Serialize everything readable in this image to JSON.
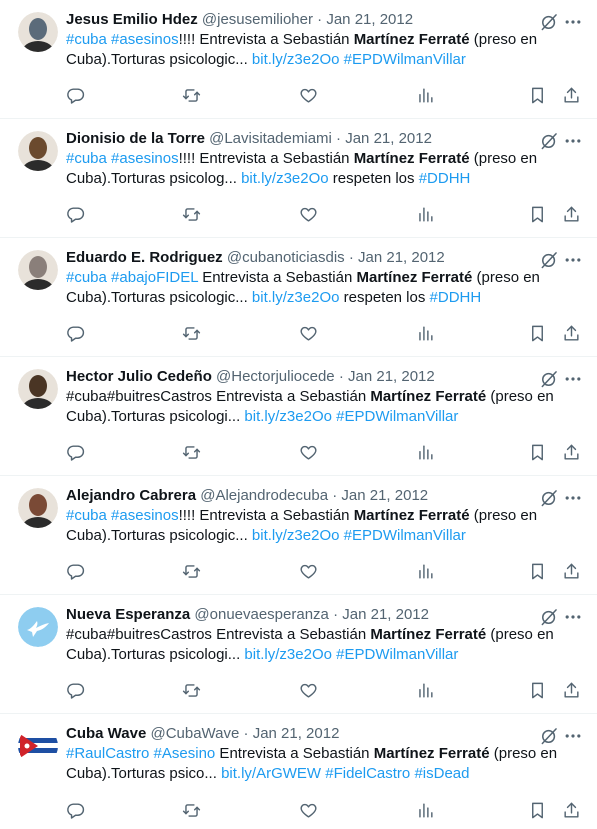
{
  "tweets": [
    {
      "name": "Jesus Emilio Hdez",
      "handle": "@jesusemilioher",
      "date": "Jan 21, 2012",
      "avatar_bg": "#5b6b7a",
      "segments": [
        {
          "t": "#cuba",
          "s": "link"
        },
        {
          "t": " ",
          "s": "text"
        },
        {
          "t": "#asesinos",
          "s": "link"
        },
        {
          "t": "!!!! Entrevista a Sebastián ",
          "s": "text"
        },
        {
          "t": "Martínez Ferraté",
          "s": "bold"
        },
        {
          "t": " (preso en Cuba).Torturas psicologic... ",
          "s": "text"
        },
        {
          "t": "bit.ly/z3e2Oo",
          "s": "link"
        },
        {
          "t": " ",
          "s": "text"
        },
        {
          "t": "#EPDWilmanVillar",
          "s": "link"
        }
      ]
    },
    {
      "name": "Dionisio de la Torre",
      "handle": "@Lavisitademiami",
      "date": "Jan 21, 2012",
      "avatar_bg": "#6b4a2e",
      "segments": [
        {
          "t": "#cuba",
          "s": "link"
        },
        {
          "t": " ",
          "s": "text"
        },
        {
          "t": "#asesinos",
          "s": "link"
        },
        {
          "t": "!!!! Entrevista a Sebastián ",
          "s": "text"
        },
        {
          "t": "Martínez Ferraté",
          "s": "bold"
        },
        {
          "t": " (preso en Cuba).Torturas psicolog... ",
          "s": "text"
        },
        {
          "t": "bit.ly/z3e2Oo",
          "s": "link"
        },
        {
          "t": " respeten los ",
          "s": "text"
        },
        {
          "t": "#DDHH",
          "s": "link"
        }
      ]
    },
    {
      "name": "Eduardo E. Rodriguez",
      "handle": "@cubanoticiasdis",
      "date": "Jan 21, 2012",
      "avatar_bg": "#8a7f7a",
      "segments": [
        {
          "t": "#cuba",
          "s": "link"
        },
        {
          "t": " ",
          "s": "text"
        },
        {
          "t": "#abajoFIDEL",
          "s": "link"
        },
        {
          "t": " Entrevista a Sebastián ",
          "s": "text"
        },
        {
          "t": "Martínez Ferraté",
          "s": "bold"
        },
        {
          "t": " (preso en Cuba).Torturas psicologic... ",
          "s": "text"
        },
        {
          "t": "bit.ly/z3e2Oo",
          "s": "link"
        },
        {
          "t": " respeten los ",
          "s": "text"
        },
        {
          "t": "#DDHH",
          "s": "link"
        }
      ]
    },
    {
      "name": "Hector Julio Cedeño",
      "handle": "@Hectorjuliocede",
      "date": "Jan 21, 2012",
      "avatar_bg": "#4a3524",
      "segments": [
        {
          "t": "#cuba#buitresCastros Entrevista a Sebastián ",
          "s": "text"
        },
        {
          "t": "Martínez Ferraté",
          "s": "bold"
        },
        {
          "t": " (preso en Cuba).Torturas psicologi... ",
          "s": "text"
        },
        {
          "t": "bit.ly/z3e2Oo",
          "s": "link"
        },
        {
          "t": " ",
          "s": "text"
        },
        {
          "t": "#EPDWilmanVillar",
          "s": "link"
        }
      ]
    },
    {
      "name": "Alejandro Cabrera",
      "handle": "@Alejandrodecuba",
      "date": "Jan 21, 2012",
      "avatar_bg": "#7a4a36",
      "segments": [
        {
          "t": "#cuba",
          "s": "link"
        },
        {
          "t": " ",
          "s": "text"
        },
        {
          "t": "#asesinos",
          "s": "link"
        },
        {
          "t": "!!!! Entrevista a Sebastián ",
          "s": "text"
        },
        {
          "t": "Martínez Ferraté",
          "s": "bold"
        },
        {
          "t": " (preso en Cuba).Torturas psicologic... ",
          "s": "text"
        },
        {
          "t": "bit.ly/z3e2Oo",
          "s": "link"
        },
        {
          "t": " ",
          "s": "text"
        },
        {
          "t": "#EPDWilmanVillar",
          "s": "link"
        }
      ]
    },
    {
      "name": "Nueva Esperanza",
      "handle": "@onuevaesperanza",
      "date": "Jan 21, 2012",
      "avatar_bg": "#8ecdf0",
      "segments": [
        {
          "t": "#cuba#buitresCastros Entrevista a Sebastián ",
          "s": "text"
        },
        {
          "t": "Martínez Ferraté",
          "s": "bold"
        },
        {
          "t": " (preso en Cuba).Torturas psicologi... ",
          "s": "text"
        },
        {
          "t": "bit.ly/z3e2Oo",
          "s": "link"
        },
        {
          "t": " ",
          "s": "text"
        },
        {
          "t": "#EPDWilmanVillar",
          "s": "link"
        }
      ]
    },
    {
      "name": "Cuba Wave",
      "handle": "@CubaWave",
      "date": "Jan 21, 2012",
      "avatar_bg": "#1e4fa3",
      "segments": [
        {
          "t": "#RaulCastro",
          "s": "link"
        },
        {
          "t": " ",
          "s": "text"
        },
        {
          "t": "#Asesino",
          "s": "link"
        },
        {
          "t": " Entrevista a Sebastián ",
          "s": "text"
        },
        {
          "t": "Martínez Ferraté",
          "s": "bold"
        },
        {
          "t": " (preso en Cuba).Torturas psico... ",
          "s": "text"
        },
        {
          "t": "bit.ly/ArGWEW",
          "s": "link"
        },
        {
          "t": " ",
          "s": "text"
        },
        {
          "t": "#FidelCastro",
          "s": "link"
        },
        {
          "t": " ",
          "s": "text"
        },
        {
          "t": "#isDead",
          "s": "link"
        }
      ]
    }
  ],
  "actions": [
    "reply-icon",
    "retweet-icon",
    "like-icon",
    "views-icon",
    "bookmark-icon",
    "share-icon"
  ],
  "colors": {
    "link": "#1d9bf0",
    "muted": "#536471",
    "text": "#0f1419",
    "divider": "#eff3f4"
  }
}
